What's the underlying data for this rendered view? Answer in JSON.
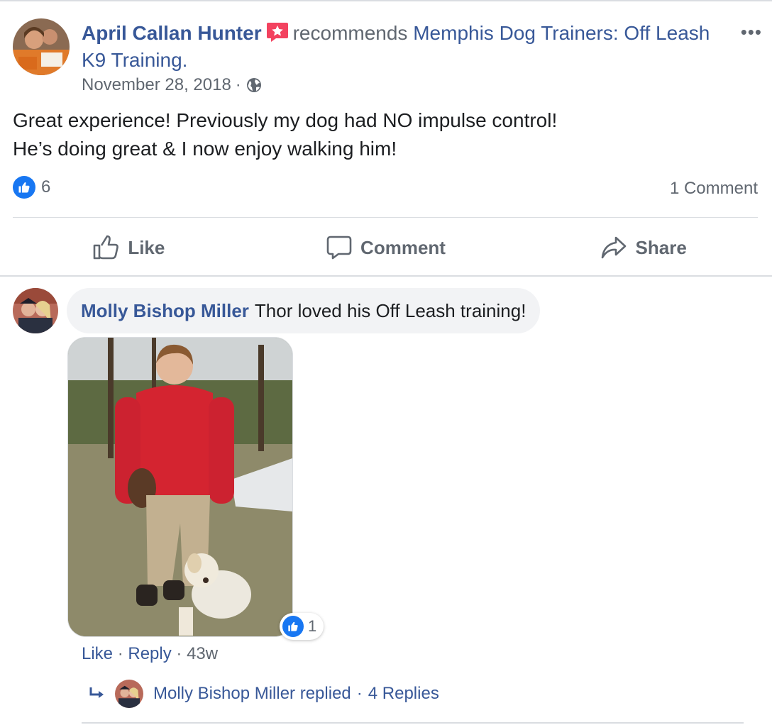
{
  "post": {
    "author": "April Callan Hunter",
    "recommends_word": "recommends",
    "page_name": "Memphis Dog Trainers: Off Leash K9 Training.",
    "date": "November 28, 2018",
    "date_sep": "·",
    "body_line1": "Great experience! Previously my dog had NO impulse control!",
    "body_line2": "He’s doing great & I now enjoy walking him!",
    "like_count": "6",
    "comment_count": "1 Comment",
    "more_label": "•••"
  },
  "actions": {
    "like": "Like",
    "comment": "Comment",
    "share": "Share"
  },
  "comment": {
    "author": "Molly Bishop Miller",
    "text": "Thor loved his Off Leash training!",
    "photo_reaction_count": "1",
    "like": "Like",
    "reply": "Reply",
    "age": "43w",
    "sep": "·"
  },
  "replies": {
    "author_replied": "Molly Bishop Miller replied",
    "sep": "·",
    "count": "4 Replies"
  },
  "colors": {
    "link_blue": "#385898",
    "meta_gray": "#606770",
    "like_blue": "#1877f2",
    "recommend_red": "#f3425f"
  },
  "icons": [
    "recommend-star-icon",
    "globe-icon",
    "like-thumb-icon",
    "comment-bubble-icon",
    "share-arrow-icon",
    "reply-arrow-icon",
    "more-dots-icon"
  ]
}
